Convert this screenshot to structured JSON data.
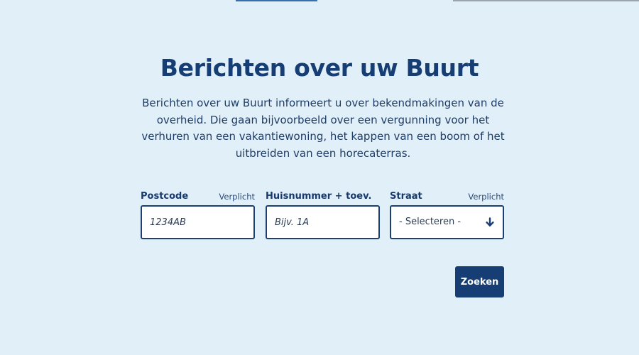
{
  "page": {
    "title": "Berichten over uw Buurt",
    "intro": "Berichten over uw Buurt informeert u over bekendmakingen van de overheid. Die gaan bijvoorbeeld over een vergunning voor het verhuren van een vakantiewoning, het kappen van een boom of het uitbreiden van een horecaterras."
  },
  "form": {
    "postcode": {
      "label": "Postcode",
      "required_text": "Verplicht",
      "placeholder": "1234AB"
    },
    "huisnummer": {
      "label": "Huisnummer + toev.",
      "placeholder": "Bijv. 1A"
    },
    "straat": {
      "label": "Straat",
      "required_text": "Verplicht",
      "selected": "- Selecteren -",
      "icon": "arrow-down-icon"
    },
    "submit_label": "Zoeken"
  },
  "colors": {
    "background": "#e1eff9",
    "primary": "#163e74",
    "input_border": "#1b3f70",
    "input_background": "#ffffff"
  }
}
